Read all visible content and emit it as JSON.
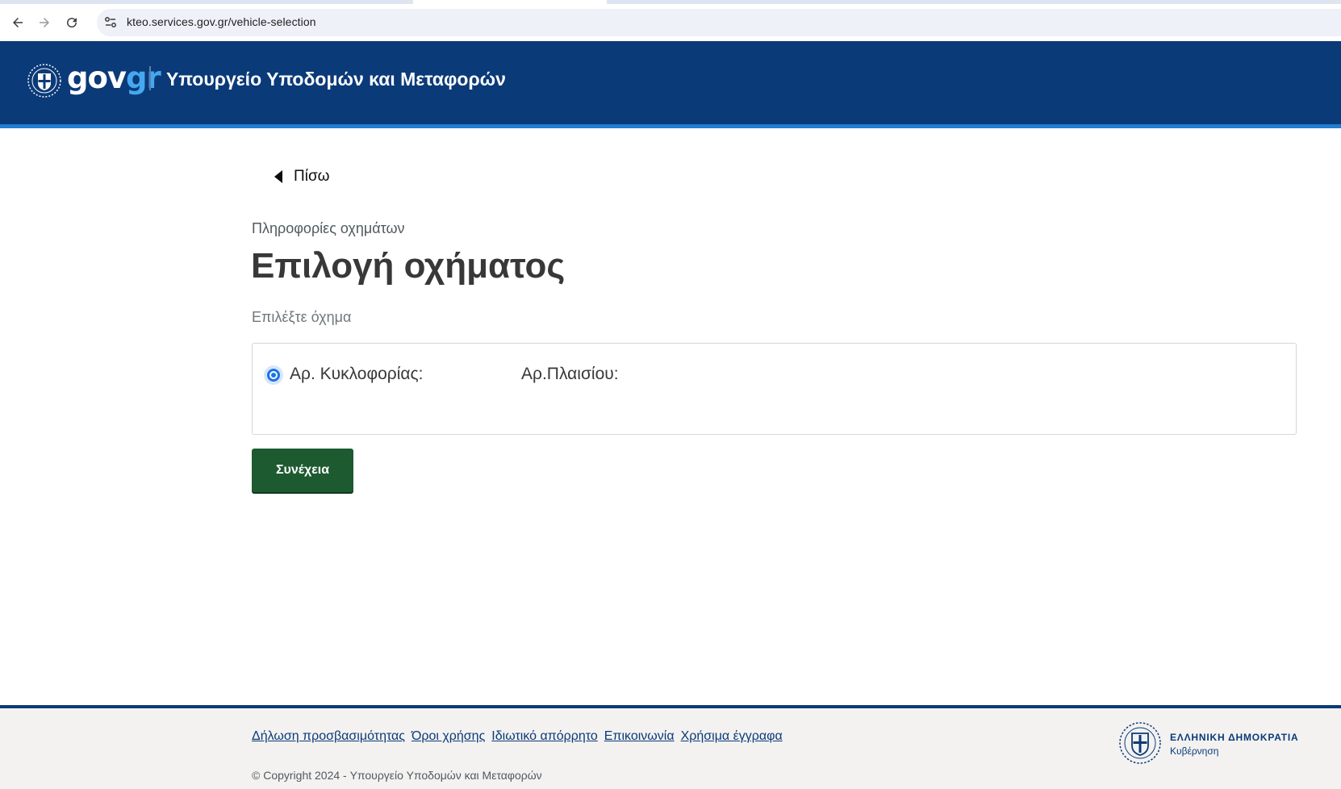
{
  "browser": {
    "url": "kteo.services.gov.gr/vehicle-selection"
  },
  "header": {
    "brand_gov": "gov",
    "brand_gr": "gr",
    "ministry": "Υπουργείο Υποδομών και Μεταφορών",
    "colors": {
      "background": "#0b3a78",
      "accent": "#1f7fd0",
      "brand_gr": "#45a8f0"
    }
  },
  "main": {
    "back_label": "Πίσω",
    "caption": "Πληροφορίες οχημάτων",
    "title": "Επιλογή οχήματος",
    "hint": "Επιλέξτε όχημα",
    "vehicle": {
      "plate_label": "Αρ. Κυκλοφορίας:",
      "chassis_label": "Αρ.Πλαισίου:",
      "selected": true
    },
    "continue_label": "Συνέχεια",
    "colors": {
      "button": "#1d5a30",
      "radio": "#1a73e8"
    }
  },
  "footer": {
    "links": [
      "Δήλωση προσβασιμότητας",
      "Όροι χρήσης",
      "Ιδιωτικό απόρρητο",
      "Επικοινωνία",
      "Χρήσιμα έγγραφα"
    ],
    "copyright": "© Copyright 2024 - Υπουργείο Υποδομών και Μεταφορών",
    "republic": "ΕΛΛΗΝΙΚΗ ΔΗΜΟΚΡΑΤΙΑ",
    "government": "Κυβέρνηση"
  }
}
